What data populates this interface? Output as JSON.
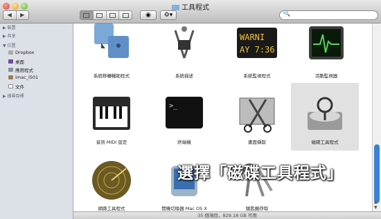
{
  "window": {
    "title": "工具程式"
  },
  "toolbar": {
    "back": "◀",
    "forward": "▶",
    "eye": "◉",
    "gear": "⚙▾",
    "search_icon": "🔍"
  },
  "sidebar": {
    "devices_header": "▶ 裝置",
    "shared_header": "▶ 共享",
    "places_header": "▼ 位置",
    "places": [
      "Dropbox",
      "桌面",
      "應用程式",
      "imac_i501",
      "文件"
    ],
    "search_header": "▶ 搜尋目標"
  },
  "apps": [
    {
      "label": "系統移轉輔助程式",
      "icon": "migration-assistant-icon"
    },
    {
      "label": "系統描述",
      "icon": "system-profiler-icon"
    },
    {
      "label": "系統監視程式",
      "icon": "console-icon"
    },
    {
      "label": "活動監視器",
      "icon": "activity-monitor-icon"
    },
    {
      "label": "音訊 MIDI 設定",
      "icon": "audio-midi-setup-icon"
    },
    {
      "label": "終端機",
      "icon": "terminal-icon"
    },
    {
      "label": "畫面擷取",
      "icon": "grab-icon"
    },
    {
      "label": "磁碟工具程式",
      "icon": "disk-utility-icon"
    },
    {
      "label": "網路工具程式",
      "icon": "network-utility-icon"
    },
    {
      "label": "開機切換器 Mac OS X",
      "icon": "boot-camp-icon"
    },
    {
      "label": "鑰匙圈存取",
      "icon": "keychain-access-icon"
    }
  ],
  "console_text": {
    "line1": "WARNI",
    "line2": "AY 7:36"
  },
  "terminal_prompt": ">_",
  "status": {
    "text": "35 個項目，829.18 GB 可用"
  },
  "callout": {
    "text": "選擇「磁碟工具程式」"
  }
}
